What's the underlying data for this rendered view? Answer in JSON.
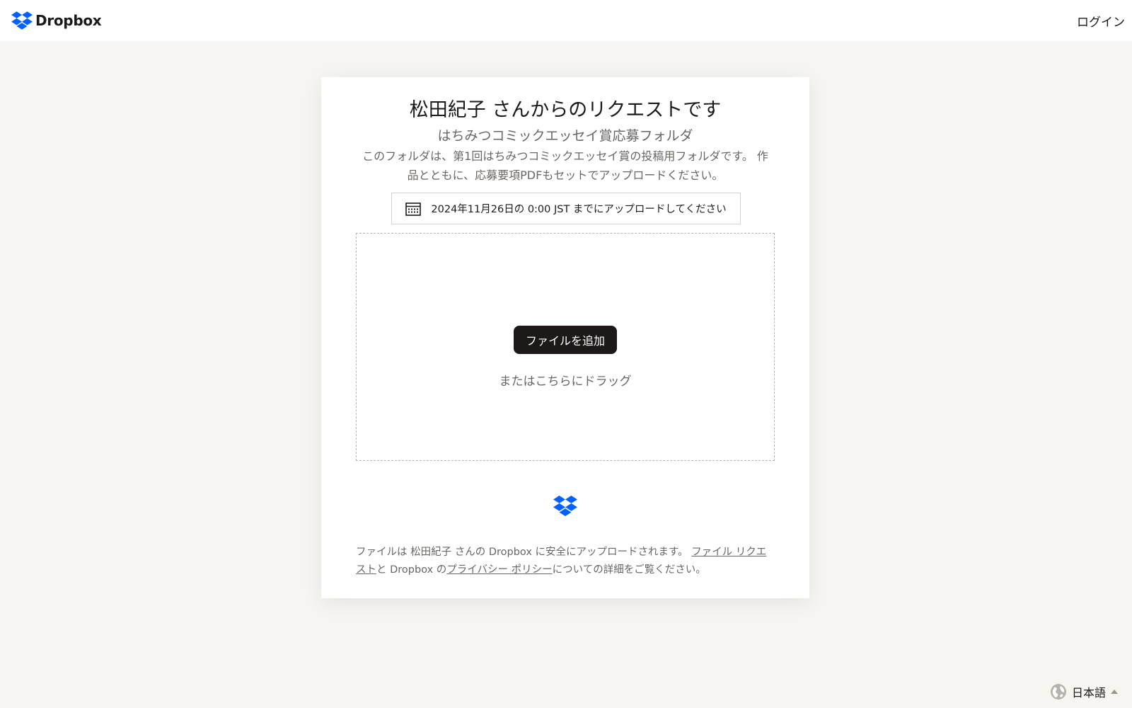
{
  "header": {
    "brand_name": "Dropbox",
    "login_label": "ログイン"
  },
  "request": {
    "title": "松田紀子 さんからのリクエストです",
    "folder_name": "はちみつコミックエッセイ賞応募フォルダ",
    "description": "このフォルダは、第1回はちみつコミックエッセイ賞の投稿用フォルダです。 作品とともに、応募要項PDFもセットでアップロードください。",
    "deadline": "2024年11月26日の 0:00 JST までにアップロードしてください"
  },
  "upload": {
    "add_files_label": "ファイルを追加",
    "drag_hint": "またはこちらにドラッグ"
  },
  "footer_note": {
    "prefix": "ファイルは 松田紀子 さんの Dropbox に安全にアップロードされます。 ",
    "link_file_requests": "ファイル リクエスト",
    "middle": "と Dropbox の",
    "link_privacy": "プライバシー ポリシー",
    "suffix": "についての詳細をご覧ください。"
  },
  "language": {
    "selected": "日本語"
  },
  "icons": {
    "brand": "dropbox-logo-icon",
    "calendar": "calendar-icon",
    "globe": "globe-icon",
    "caret": "caret-up-icon"
  },
  "colors": {
    "brand_blue": "#0061fe",
    "button_dark": "#1e1919",
    "page_background": "#f7f5f2"
  }
}
